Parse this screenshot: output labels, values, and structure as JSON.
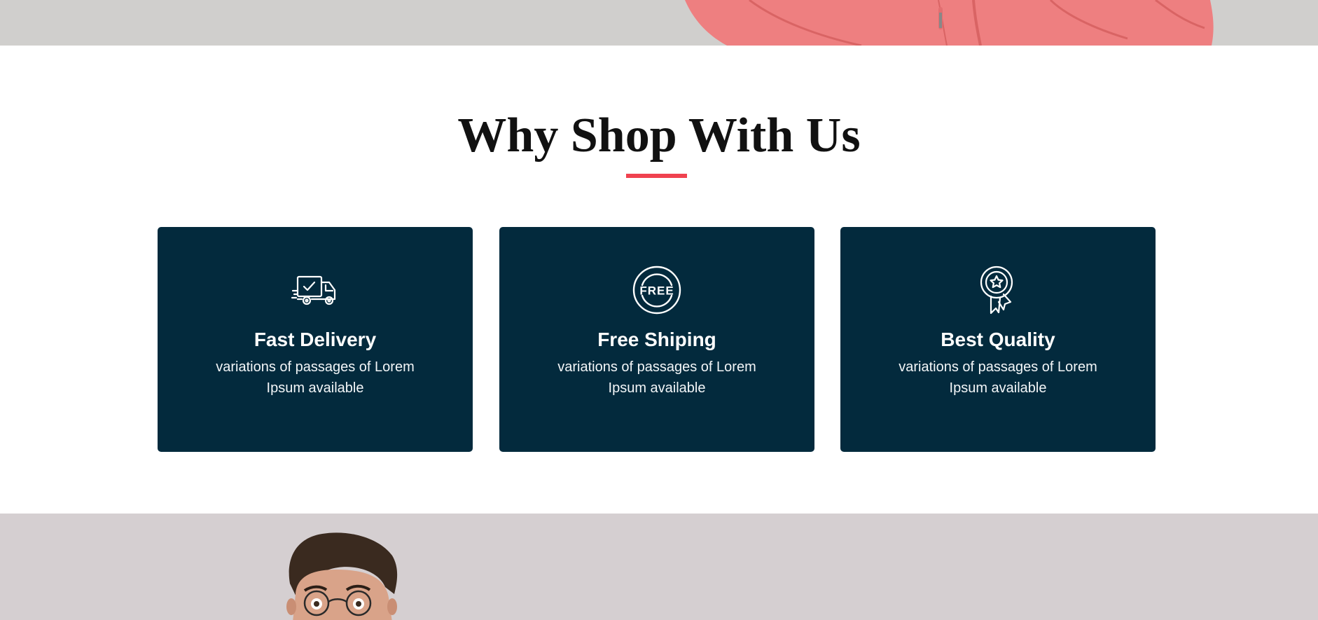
{
  "section": {
    "title": "Why Shop With Us",
    "accent_color": "#f0424f",
    "card_background": "#032a3d"
  },
  "features": [
    {
      "icon": "delivery-truck-icon",
      "title": "Fast Delivery",
      "text": "variations of passages of Lorem Ipsum available"
    },
    {
      "icon": "free-badge-icon",
      "title": "Free Shiping",
      "text": "variations of passages of Lorem Ipsum available"
    },
    {
      "icon": "award-ribbon-icon",
      "title": "Best Quality",
      "text": "variations of passages of Lorem Ipsum available"
    }
  ],
  "icons": {
    "free_badge_label": "FREE"
  }
}
